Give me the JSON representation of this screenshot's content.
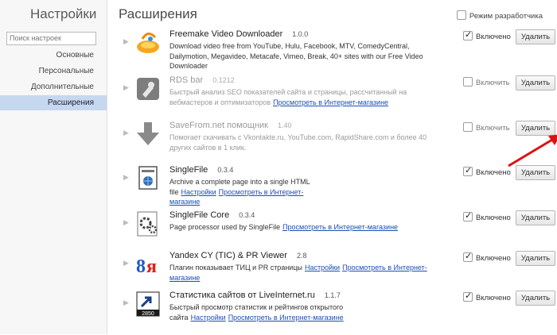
{
  "sidebar": {
    "title": "Настройки",
    "search_placeholder": "Поиск настроек",
    "items": [
      {
        "label": "Основные"
      },
      {
        "label": "Персональные"
      },
      {
        "label": "Дополнительные"
      },
      {
        "label": "Расширения",
        "active": true
      }
    ]
  },
  "main": {
    "title": "Расширения",
    "developer_mode_label": "Режим разработчика",
    "extensions": [
      {
        "name": "Freemake Video Downloader",
        "version": "1.0.0",
        "description": "Download video free from YouTube, Hulu, Facebook, MTV, ComedyCentral, Dailymotion, Megavideo, Metacafe, Vimeo, Break, 40+ sites with our Free Video Downloader",
        "enabled": true,
        "toggle_label": "Включено",
        "delete_label": "Удалить",
        "icon": "freemake-icon"
      },
      {
        "name": "RDS bar",
        "version": "0.1212",
        "description": "Быстрый анализ SEO показателей сайта и страницы, рассчитанный на вебмастеров и оптимизаторов",
        "link_store": "Просмотреть в Интернет-магазине",
        "enabled": false,
        "toggle_label": "Включить",
        "delete_label": "Удалить",
        "icon": "rds-bar-icon"
      },
      {
        "name": "SaveFrom.net помощник",
        "version": "1.40",
        "description": "Помогает скачивать с Vkontakte.ru, YouTube.com, RapidShare.com и более 40 других сайтов в 1 клик.",
        "enabled": false,
        "toggle_label": "Включить",
        "delete_label": "Удалить",
        "icon": "download-arrow-icon"
      },
      {
        "name": "SingleFile",
        "version": "0.3.4",
        "description": "Archive a complete page into a single HTML file",
        "link_settings": "Настройки",
        "link_store": "Просмотреть в Интернет-магазине",
        "enabled": true,
        "toggle_label": "Включено",
        "delete_label": "Удалить",
        "icon": "singlefile-icon"
      },
      {
        "name": "SingleFile Core",
        "version": "0.3.4",
        "description": "Page processor used by SingleFile",
        "link_store": "Просмотреть в Интернет-магазине",
        "enabled": true,
        "toggle_label": "Включено",
        "delete_label": "Удалить",
        "icon": "gears-icon"
      },
      {
        "name": "Yandex CY (TIC) & PR Viewer",
        "version": "2.8",
        "description": "Плагин показывает ТИЦ и PR страницы",
        "link_settings": "Настройки",
        "link_store": "Просмотреть в Интернет-магазине",
        "enabled": true,
        "toggle_label": "Включено",
        "delete_label": "Удалить",
        "icon": "yandex-icon"
      },
      {
        "name": "Статистика сайтов от LiveInternet.ru",
        "version": "1.1.7",
        "description": "Быстрый просмотр статистик и рейтингов открытого сайта",
        "link_settings": "Настройки",
        "link_store": "Просмотреть в Интернет-магазине",
        "enabled": true,
        "toggle_label": "Включено",
        "delete_label": "Удалить",
        "icon": "liveinternet-icon",
        "icon_text": "2850"
      }
    ]
  },
  "colors": {
    "link": "#1a4fb5",
    "active_nav": "#c6d7f0",
    "arrow": "#e01010"
  }
}
